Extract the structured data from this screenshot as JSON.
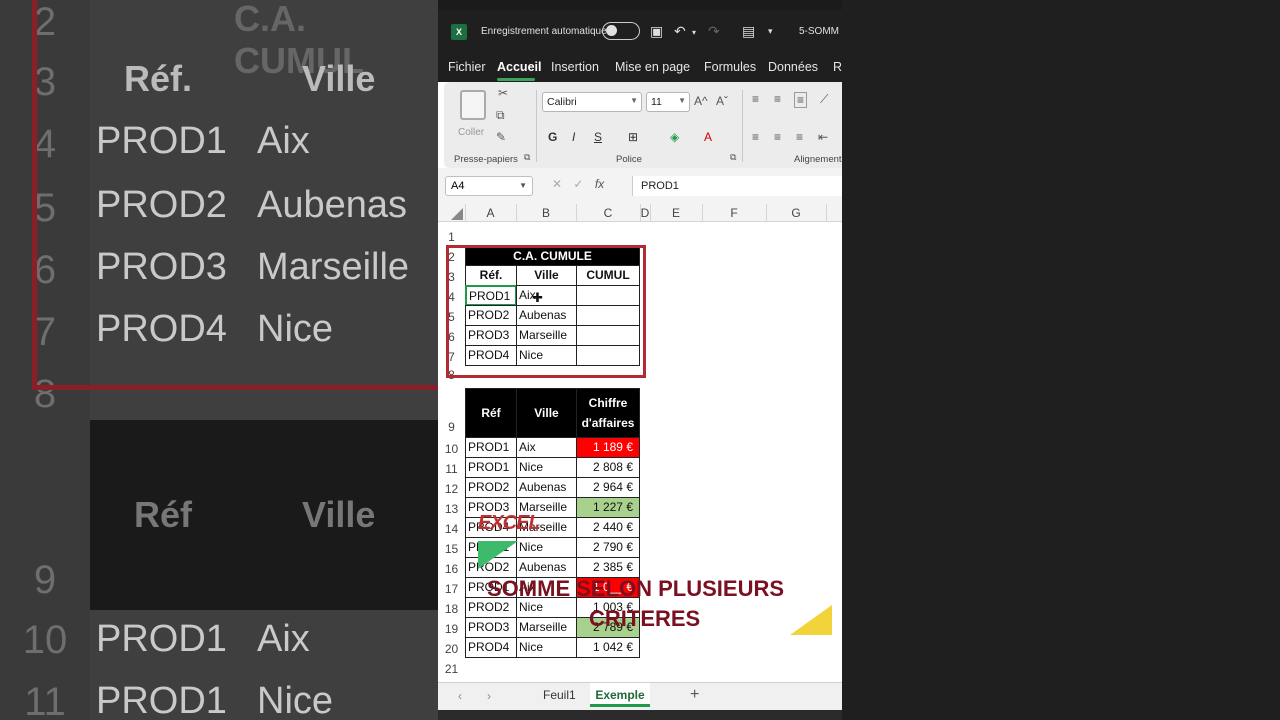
{
  "titlebar": {
    "logo": "X",
    "autosave_label": "Enregistrement automatique",
    "filename": "5-SOMM"
  },
  "menu": [
    "Fichier",
    "Accueil",
    "Insertion",
    "Mise en page",
    "Formules",
    "Données",
    "Re"
  ],
  "menu_active": "Accueil",
  "ribbon": {
    "paste_label": "Coller",
    "clipboard_label": "Presse-papiers",
    "font_name": "Calibri",
    "font_size": "11",
    "police_label": "Police",
    "alignment_label": "Alignement",
    "bold": "G",
    "italic": "I",
    "underline": "S",
    "grow_font": "A^",
    "shrink_font": "Aˇ"
  },
  "formula_bar": {
    "name_box": "A4",
    "fx": "fx",
    "value": "PROD1"
  },
  "columns": [
    "A",
    "B",
    "C",
    "D",
    "E",
    "F",
    "G"
  ],
  "rows": [
    "1",
    "2",
    "3",
    "4",
    "5",
    "6",
    "7",
    "8",
    "9",
    "10",
    "11",
    "12",
    "13",
    "14",
    "15",
    "16",
    "17",
    "18",
    "19",
    "20",
    "21"
  ],
  "summary_table": {
    "title": "C.A. CUMULE",
    "headers": [
      "Réf.",
      "Ville",
      "CUMUL"
    ],
    "rows": [
      [
        "PROD1",
        "Aix",
        ""
      ],
      [
        "PROD2",
        "Aubenas",
        ""
      ],
      [
        "PROD3",
        "Marseille",
        ""
      ],
      [
        "PROD4",
        "Nice",
        ""
      ]
    ]
  },
  "data_table": {
    "headers": [
      "Réf",
      "Ville",
      "Chiffre d'affaires"
    ],
    "rows": [
      [
        "PROD1",
        "Aix",
        "1 189 €"
      ],
      [
        "PROD1",
        "Nice",
        "2 808 €"
      ],
      [
        "PROD2",
        "Aubenas",
        "2 964 €"
      ],
      [
        "PROD3",
        "Marseille",
        "1 227 €"
      ],
      [
        "PROD4",
        "Marseille",
        "2 440 €"
      ],
      [
        "PROD1",
        "Nice",
        "2 790 €"
      ],
      [
        "PROD2",
        "Aubenas",
        "2 385 €"
      ],
      [
        "PROD1",
        "Aix",
        "1 0__ €"
      ],
      [
        "PROD2",
        "Nice",
        "1 003 €"
      ],
      [
        "PROD3",
        "Marseille",
        "2 789 €"
      ],
      [
        "PROD4",
        "Nice",
        "1 042 €"
      ]
    ]
  },
  "sheets": [
    "Feuil1",
    "Exemple"
  ],
  "active_sheet": "Exemple",
  "overlay": {
    "brand": "EXCEL",
    "title_line1": "SOMME SELON PLUSIEURS",
    "title_line2": "CRITERES"
  },
  "background_zoom": {
    "title": "C.A. CUMUL",
    "headers": [
      "Réf.",
      "Ville"
    ],
    "rows": [
      [
        "PROD1",
        "Aix"
      ],
      [
        "PROD2",
        "Aubenas"
      ],
      [
        "PROD3",
        "Marseille"
      ],
      [
        "PROD4",
        "Nice"
      ]
    ],
    "headers2": [
      "Réf",
      "Ville"
    ],
    "rows2": [
      [
        "PROD1",
        "Aix"
      ],
      [
        "PROD1",
        "Nice"
      ]
    ],
    "row_numbers": [
      "2",
      "3",
      "4",
      "5",
      "6",
      "7",
      "8",
      "9",
      "10",
      "11"
    ]
  },
  "colors": {
    "accent_green": "#3aa55d",
    "frame_red": "#b22a34",
    "cell_red": "#ff0000",
    "cell_green": "#a9d18e",
    "overlay_text": "#7a1020",
    "overlay_yellow": "#f2d43a"
  }
}
